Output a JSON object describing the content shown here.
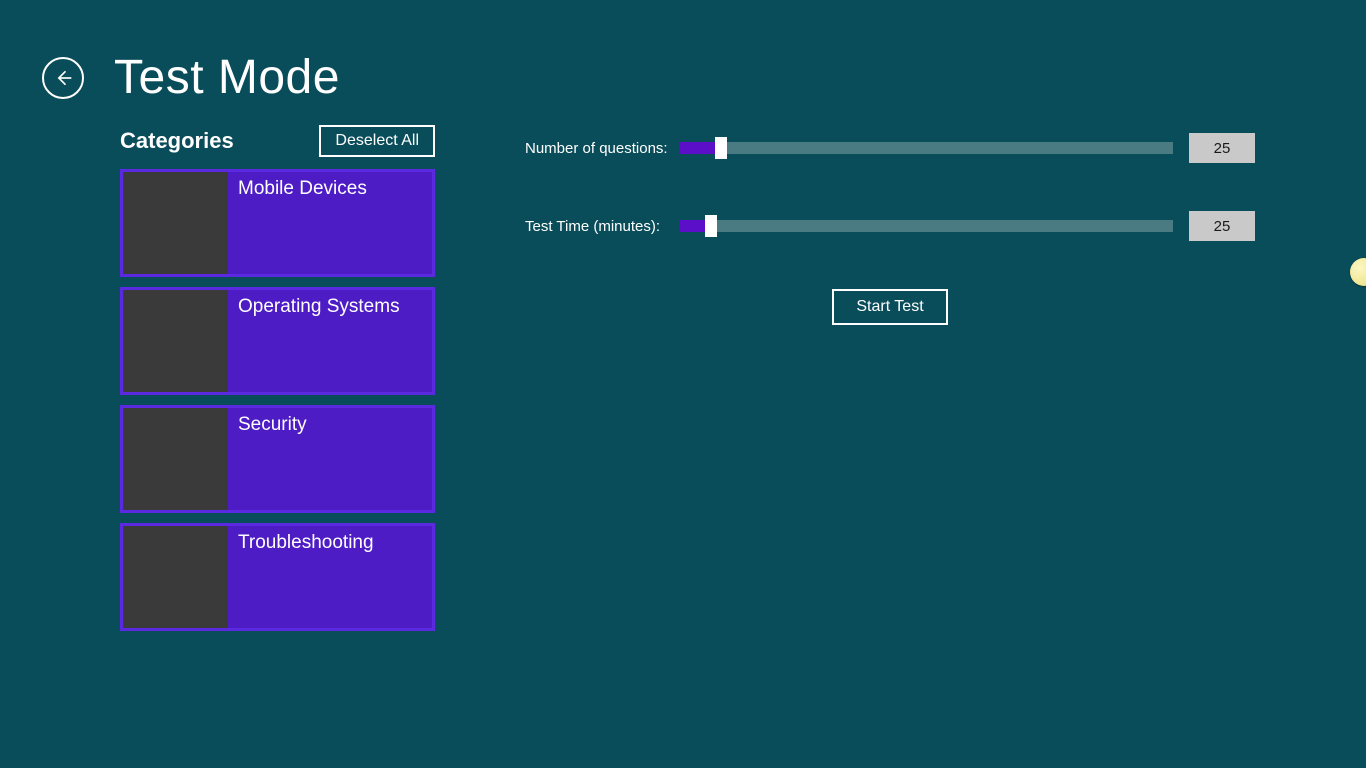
{
  "header": {
    "title": "Test Mode"
  },
  "categories": {
    "heading": "Categories",
    "deselect_label": "Deselect All",
    "items": [
      {
        "label": "Mobile Devices"
      },
      {
        "label": "Operating Systems"
      },
      {
        "label": "Security"
      },
      {
        "label": "Troubleshooting"
      }
    ]
  },
  "sliders": {
    "questions": {
      "label": "Number of questions:",
      "value": "25",
      "fill_percent": 7
    },
    "time": {
      "label": "Test Time (minutes):",
      "value": "25",
      "fill_percent": 5
    }
  },
  "actions": {
    "start_label": "Start Test"
  }
}
